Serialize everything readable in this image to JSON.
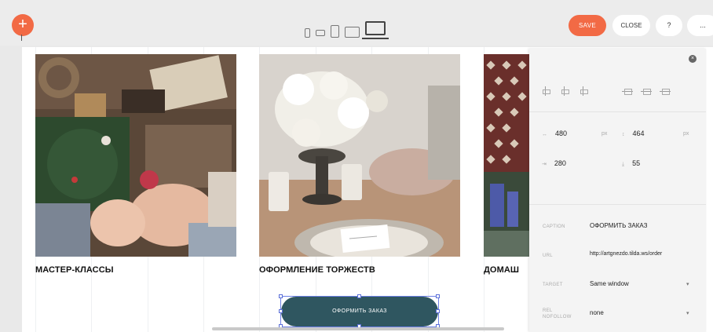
{
  "toolbar": {
    "add_icon": "+",
    "devices": [
      "phone-icon",
      "phone-landscape-icon",
      "tablet-icon",
      "tablet-landscape-icon",
      "laptop-icon"
    ],
    "save_label": "SAVE",
    "close_label": "CLOSE",
    "help_label": "?",
    "more_label": "...",
    "accent_color": "#f26a45"
  },
  "cards": [
    {
      "title": "МАСТЕР-КЛАССЫ",
      "image": "photo-workshop-crafts"
    },
    {
      "title": "ОФОРМЛЕНИЕ ТОРЖЕСТВ",
      "image": "photo-table-decoration-flowers"
    },
    {
      "title": "ДОМАШ",
      "image": "photo-home-decor-partial"
    }
  ],
  "order_button": {
    "label": "ОФОРМИТЬ ЗАКАЗ",
    "color": "#2f5660"
  },
  "panel": {
    "width_value": "480",
    "height_value": "464",
    "x_value": "280",
    "y_value": "55",
    "unit": "px",
    "caption_label": "CAPTION",
    "caption_value": "ОФОРМИТЬ ЗАКАЗ",
    "url_label": "URL",
    "url_value": "http://artgnezdo.tilda.ws/order",
    "target_label": "TARGET",
    "target_value": "Same window",
    "nofollow_label": "REL NOFOLLOW",
    "nofollow_value": "none"
  }
}
